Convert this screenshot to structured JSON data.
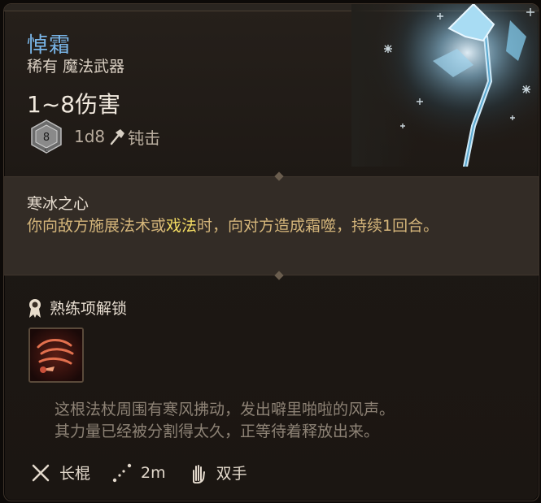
{
  "item": {
    "name": "悼霜",
    "rarity_type": "稀有 魔法武器",
    "damage": "1~8伤害",
    "die_face": "8",
    "die_letter": "C",
    "damage_dice": "1d8",
    "damage_type": "钝击",
    "name_color": "#79b5e8"
  },
  "feature": {
    "title": "寒冰之心",
    "desc_part1": "你向敌方施展法术或",
    "desc_highlight": "戏法",
    "desc_part2": "时，向对方造成霜噬，持续1回合。",
    "highlight_color": "#f4dc63"
  },
  "proficiency": {
    "label": "熟练项解锁",
    "icon": "ribbon-icon",
    "skill_icon": "wind-slash-icon"
  },
  "flavor": {
    "line1": "这根法杖周围有寒风拂动，发出噼里啪啦的风声。",
    "line2": "其力量已经被分割得太久，正等待着释放出来。"
  },
  "footer": {
    "weapon_type": "长棍",
    "range": "2m",
    "handedness": "双手"
  }
}
